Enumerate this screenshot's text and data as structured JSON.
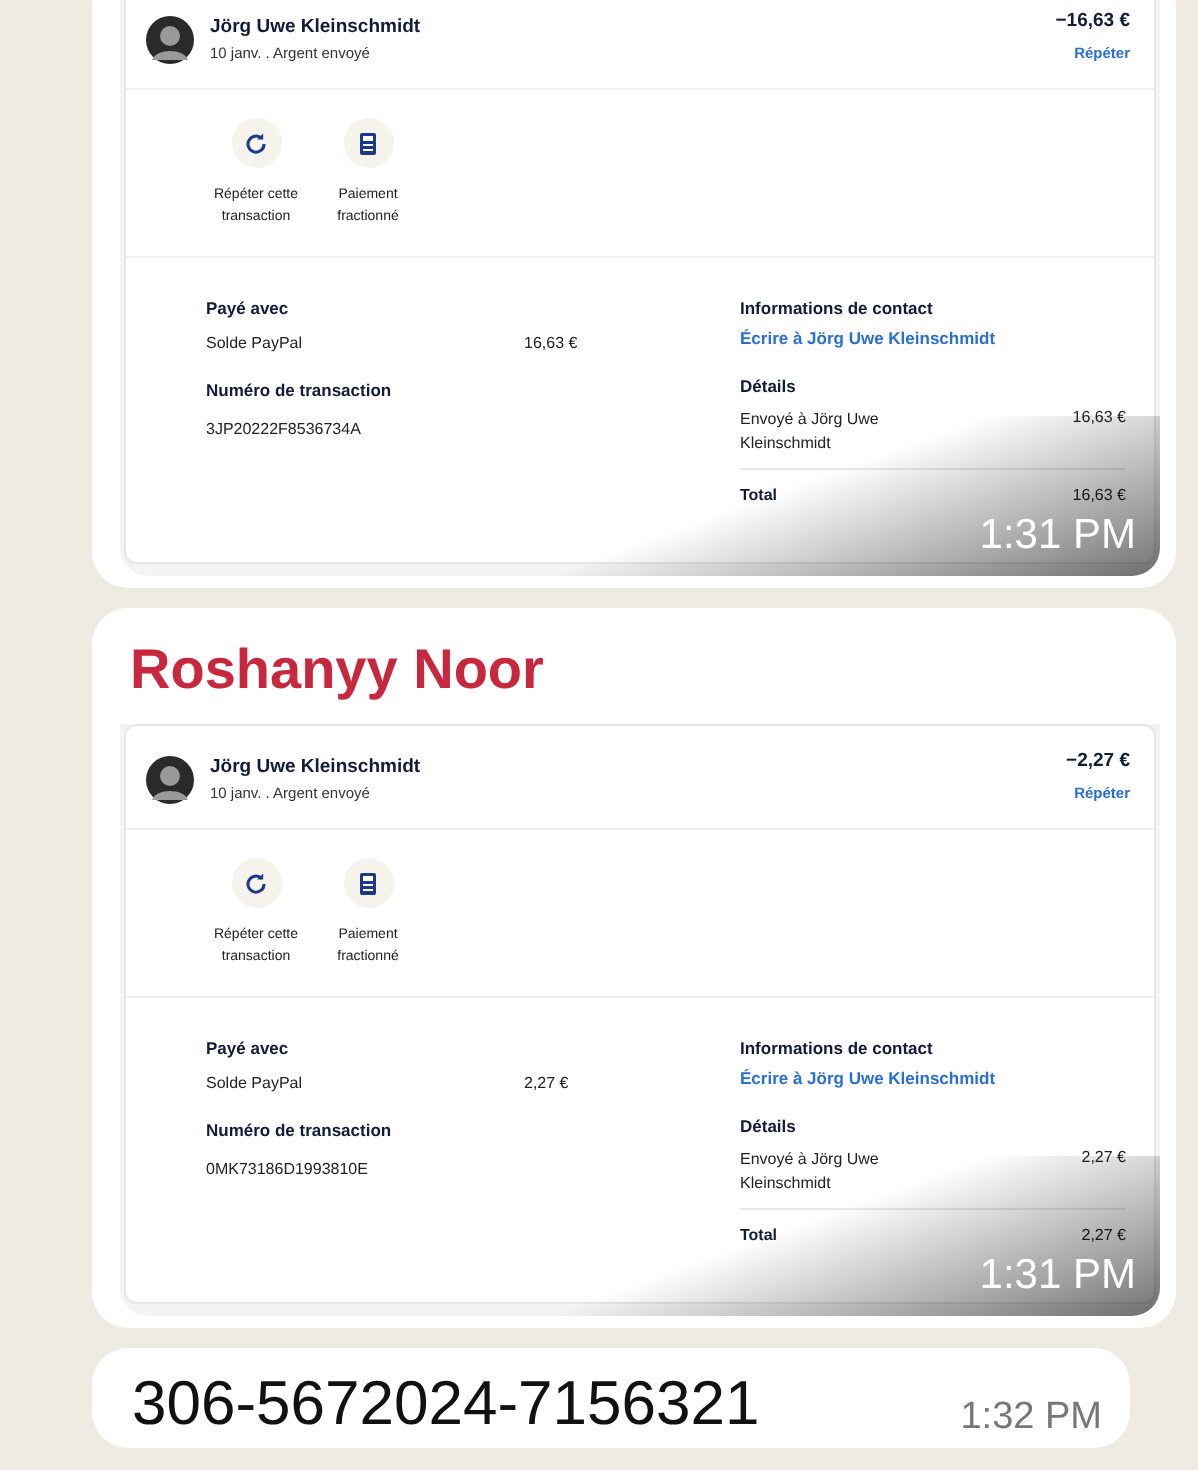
{
  "messages": [
    {
      "kind": "image",
      "time": "1:31 PM",
      "receipt": {
        "payee": "Jörg Uwe Kleinschmidt",
        "subtitle": "10 janv. . Argent envoyé",
        "amount": "−16,63 €",
        "repeat_link": "Répéter",
        "actions": [
          {
            "kind": "repeat",
            "label": "Répéter cette transaction"
          },
          {
            "kind": "split",
            "label": "Paiement fractionné"
          }
        ],
        "paid_with": {
          "heading": "Payé avec",
          "method": "Solde PayPal",
          "amount": "16,63 €"
        },
        "transaction": {
          "heading": "Numéro de transaction",
          "number": "3JP20222F8536734A"
        },
        "contact": {
          "heading": "Informations de contact",
          "link": "Écrire à Jörg Uwe Kleinschmidt"
        },
        "details": {
          "heading": "Détails",
          "line_label": "Envoyé à Jörg Uwe Kleinschmidt",
          "line_amount": "16,63 €",
          "total_label": "Total",
          "total_amount": "16,63 €"
        }
      }
    },
    {
      "kind": "image",
      "sender": "Roshanyy Noor",
      "time": "1:31 PM",
      "receipt": {
        "payee": "Jörg Uwe Kleinschmidt",
        "subtitle": "10 janv. . Argent envoyé",
        "amount": "−2,27 €",
        "repeat_link": "Répéter",
        "actions": [
          {
            "kind": "repeat",
            "label": "Répéter cette transaction"
          },
          {
            "kind": "split",
            "label": "Paiement fractionné"
          }
        ],
        "paid_with": {
          "heading": "Payé avec",
          "method": "Solde PayPal",
          "amount": "2,27 €"
        },
        "transaction": {
          "heading": "Numéro de transaction",
          "number": "0MK73186D1993810E"
        },
        "contact": {
          "heading": "Informations de contact",
          "link": "Écrire à Jörg Uwe Kleinschmidt"
        },
        "details": {
          "heading": "Détails",
          "line_label": "Envoyé à Jörg Uwe Kleinschmidt",
          "line_amount": "2,27 €",
          "total_label": "Total",
          "total_amount": "2,27 €"
        }
      }
    },
    {
      "kind": "text",
      "text": "306-5672024-7156321",
      "time": "1:32 PM"
    }
  ]
}
